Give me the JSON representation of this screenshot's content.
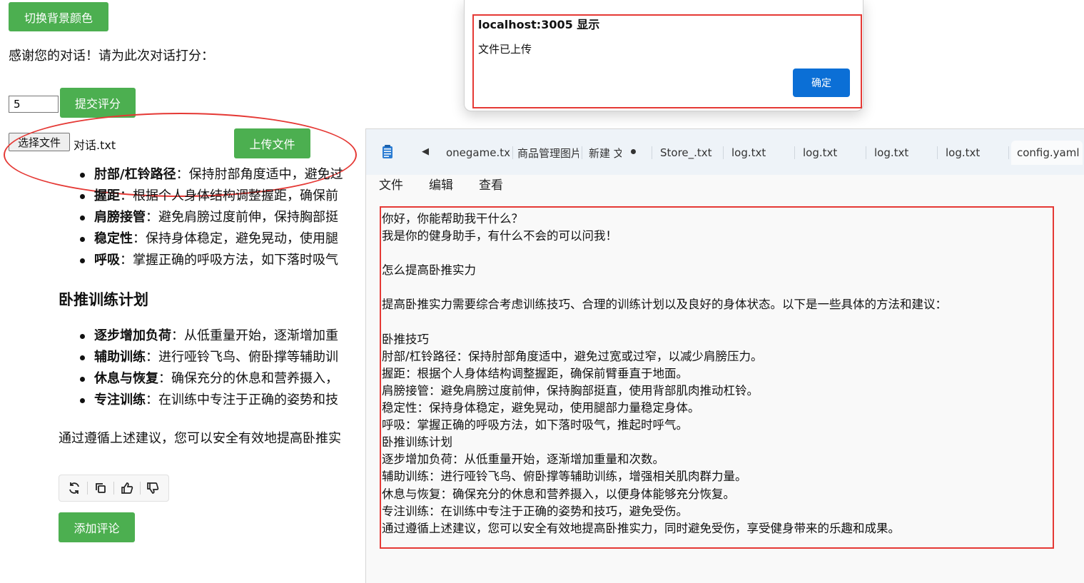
{
  "page": {
    "toggle_bg_button": "切换背景颜色",
    "rating_prompt": "感谢您的对话！请为此次对话打分：",
    "rating_value": "5",
    "submit_rating_button": "提交评分",
    "choose_file_button": "选择文件",
    "chosen_file_name": "对话.txt",
    "upload_button": "上传文件",
    "tips_list": [
      {
        "term": "肘部/杠铃路径",
        "desc": "：保持肘部角度适中，避免过"
      },
      {
        "term": "握距",
        "desc": "：根据个人身体结构调整握距，确保前"
      },
      {
        "term": "肩膀接管",
        "desc": "：避免肩膀过度前伸，保持胸部挺"
      },
      {
        "term": "稳定性",
        "desc": "：保持身体稳定，避免晃动，使用腿"
      },
      {
        "term": "呼吸",
        "desc": "：掌握正确的呼吸方法，如下落时吸气"
      }
    ],
    "plan_heading": "卧推训练计划",
    "plan_list": [
      {
        "term": "逐步增加负荷",
        "desc": "：从低重量开始，逐渐增加重"
      },
      {
        "term": "辅助训练",
        "desc": "：进行哑铃飞鸟、俯卧撑等辅助训"
      },
      {
        "term": "休息与恢复",
        "desc": "：确保充分的休息和营养摄入，"
      },
      {
        "term": "专注训练",
        "desc": "：在训练中专注于正确的姿势和技"
      }
    ],
    "conclusion": "通过遵循上述建议，您可以安全有效地提高卧推实",
    "action_icons": [
      "refresh-icon",
      "copy-icon",
      "thumbs-up-icon",
      "thumbs-down-icon"
    ],
    "add_comment_button": "添加评论",
    "accent_color": "#4caf50"
  },
  "dialog": {
    "title": "localhost:3005 显示",
    "message": "文件已上传",
    "ok_button": "确定",
    "button_color": "#0b6fd6"
  },
  "notepad": {
    "tabs": [
      "onegame.txt",
      "商品管理图片",
      "新建 文",
      "Store_.txt",
      "log.txt",
      "log.txt",
      "log.txt",
      "log.txt",
      "config.yaml"
    ],
    "menu": [
      "文件",
      "编辑",
      "查看"
    ],
    "content": "你好，你能帮助我干什么？\n我是你的健身助手，有什么不会的可以问我！\n\n怎么提高卧推实力\n\n提高卧推实力需要综合考虑训练技巧、合理的训练计划以及良好的身体状态。以下是一些具体的方法和建议：\n\n卧推技巧\n肘部/杠铃路径：保持肘部角度适中，避免过宽或过窄，以减少肩膀压力。\n握距：根据个人身体结构调整握距，确保前臂垂直于地面。\n肩膀接管：避免肩膀过度前伸，保持胸部挺直，使用背部肌肉推动杠铃。\n稳定性：保持身体稳定，避免晃动，使用腿部力量稳定身体。\n呼吸：掌握正确的呼吸方法，如下落时吸气，推起时呼气。\n卧推训练计划\n逐步增加负荷：从低重量开始，逐渐增加重量和次数。\n辅助训练：进行哑铃飞鸟、俯卧撑等辅助训练，增强相关肌肉群力量。\n休息与恢复：确保充分的休息和营养摄入，以便身体能够充分恢复。\n专注训练：在训练中专注于正确的姿势和技巧，避免受伤。\n通过遵循上述建议，您可以安全有效地提高卧推实力，同时避免受伤，享受健身带来的乐趣和成果。"
  },
  "annotation_color": "#e53935"
}
